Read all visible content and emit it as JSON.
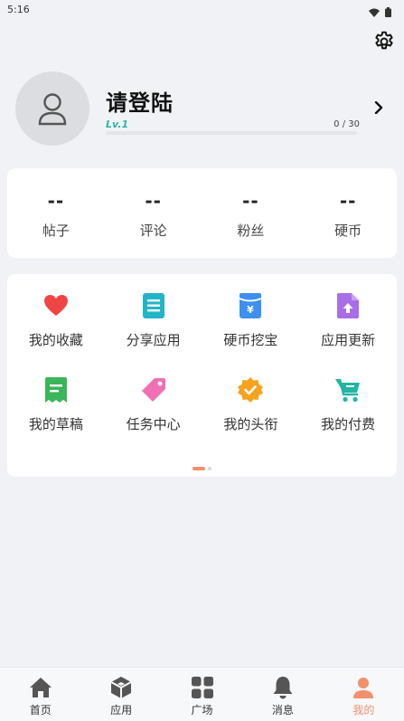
{
  "status_bar": {
    "time": "5:16"
  },
  "profile": {
    "name": "请登陆",
    "level": "Lv.1",
    "progress_text": "0 / 30",
    "progress_fraction": 0
  },
  "stats": [
    {
      "value": "--",
      "label": "帖子"
    },
    {
      "value": "--",
      "label": "评论"
    },
    {
      "value": "--",
      "label": "粉丝"
    },
    {
      "value": "--",
      "label": "硬币"
    }
  ],
  "menu": {
    "items": [
      {
        "label": "我的收藏",
        "icon": "heart-icon",
        "color": "#f04545"
      },
      {
        "label": "分享应用",
        "icon": "share-doc-icon",
        "color": "#22b5c9"
      },
      {
        "label": "硬币挖宝",
        "icon": "coin-pouch-icon",
        "color": "#3d8ff0"
      },
      {
        "label": "应用更新",
        "icon": "update-file-icon",
        "color": "#a86ee8"
      },
      {
        "label": "我的草稿",
        "icon": "draft-icon",
        "color": "#3cb55c"
      },
      {
        "label": "任务中心",
        "icon": "tag-icon",
        "color": "#f070b4"
      },
      {
        "label": "我的头衔",
        "icon": "badge-icon",
        "color": "#f6a21c"
      },
      {
        "label": "我的付费",
        "icon": "cart-icon",
        "color": "#22b5a5"
      }
    ],
    "page_index": 0,
    "page_count": 2
  },
  "bottom_nav": {
    "items": [
      {
        "label": "首页",
        "icon": "home-icon"
      },
      {
        "label": "应用",
        "icon": "cube-icon"
      },
      {
        "label": "广场",
        "icon": "grid-icon"
      },
      {
        "label": "消息",
        "icon": "bell-icon"
      },
      {
        "label": "我的",
        "icon": "person-icon"
      }
    ],
    "active": "我的"
  },
  "colors": {
    "accent": "#f2906a",
    "level": "#2bb5a3",
    "background": "#f0f2f5",
    "nav_icon": "#555555"
  }
}
